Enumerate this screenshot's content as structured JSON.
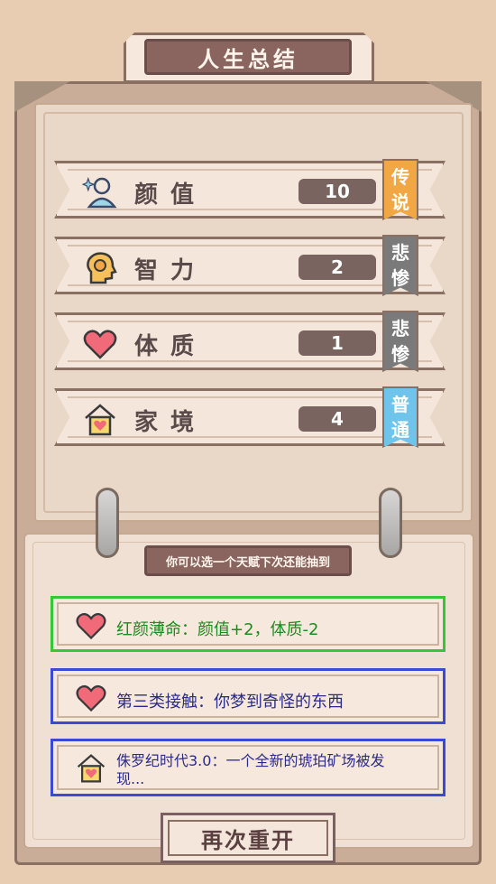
{
  "title": "人生总结",
  "stats": [
    {
      "name": "颜值",
      "value": "10",
      "rank": "传说",
      "rank_color": "#f2a745",
      "icon": "person-sparkle-icon"
    },
    {
      "name": "智力",
      "value": "2",
      "rank": "悲惨",
      "rank_color": "#7a7a7a",
      "icon": "brain-head-icon"
    },
    {
      "name": "体质",
      "value": "1",
      "rank": "悲惨",
      "rank_color": "#7a7a7a",
      "icon": "heart-icon"
    },
    {
      "name": "家境",
      "value": "4",
      "rank": "普通",
      "rank_color": "#6ec4ea",
      "icon": "house-heart-icon"
    }
  ],
  "hint": "你可以选一个天赋下次还能抽到",
  "talents": [
    {
      "text": "红颜薄命：颜值+2，体质-2",
      "color": "#1f8a1f",
      "border": "#33c83a",
      "icon": "heart-icon"
    },
    {
      "text": "第三类接触：你梦到奇怪的东西",
      "color": "#2a2a8a",
      "border": "#3a4ad6",
      "icon": "heart-icon"
    },
    {
      "text": "侏罗纪时代3.0：一个全新的琥珀矿场被发现...",
      "color": "#2a2a8a",
      "border": "#3a4ad6",
      "icon": "house-heart-icon"
    }
  ],
  "restart_label": "再次重开"
}
